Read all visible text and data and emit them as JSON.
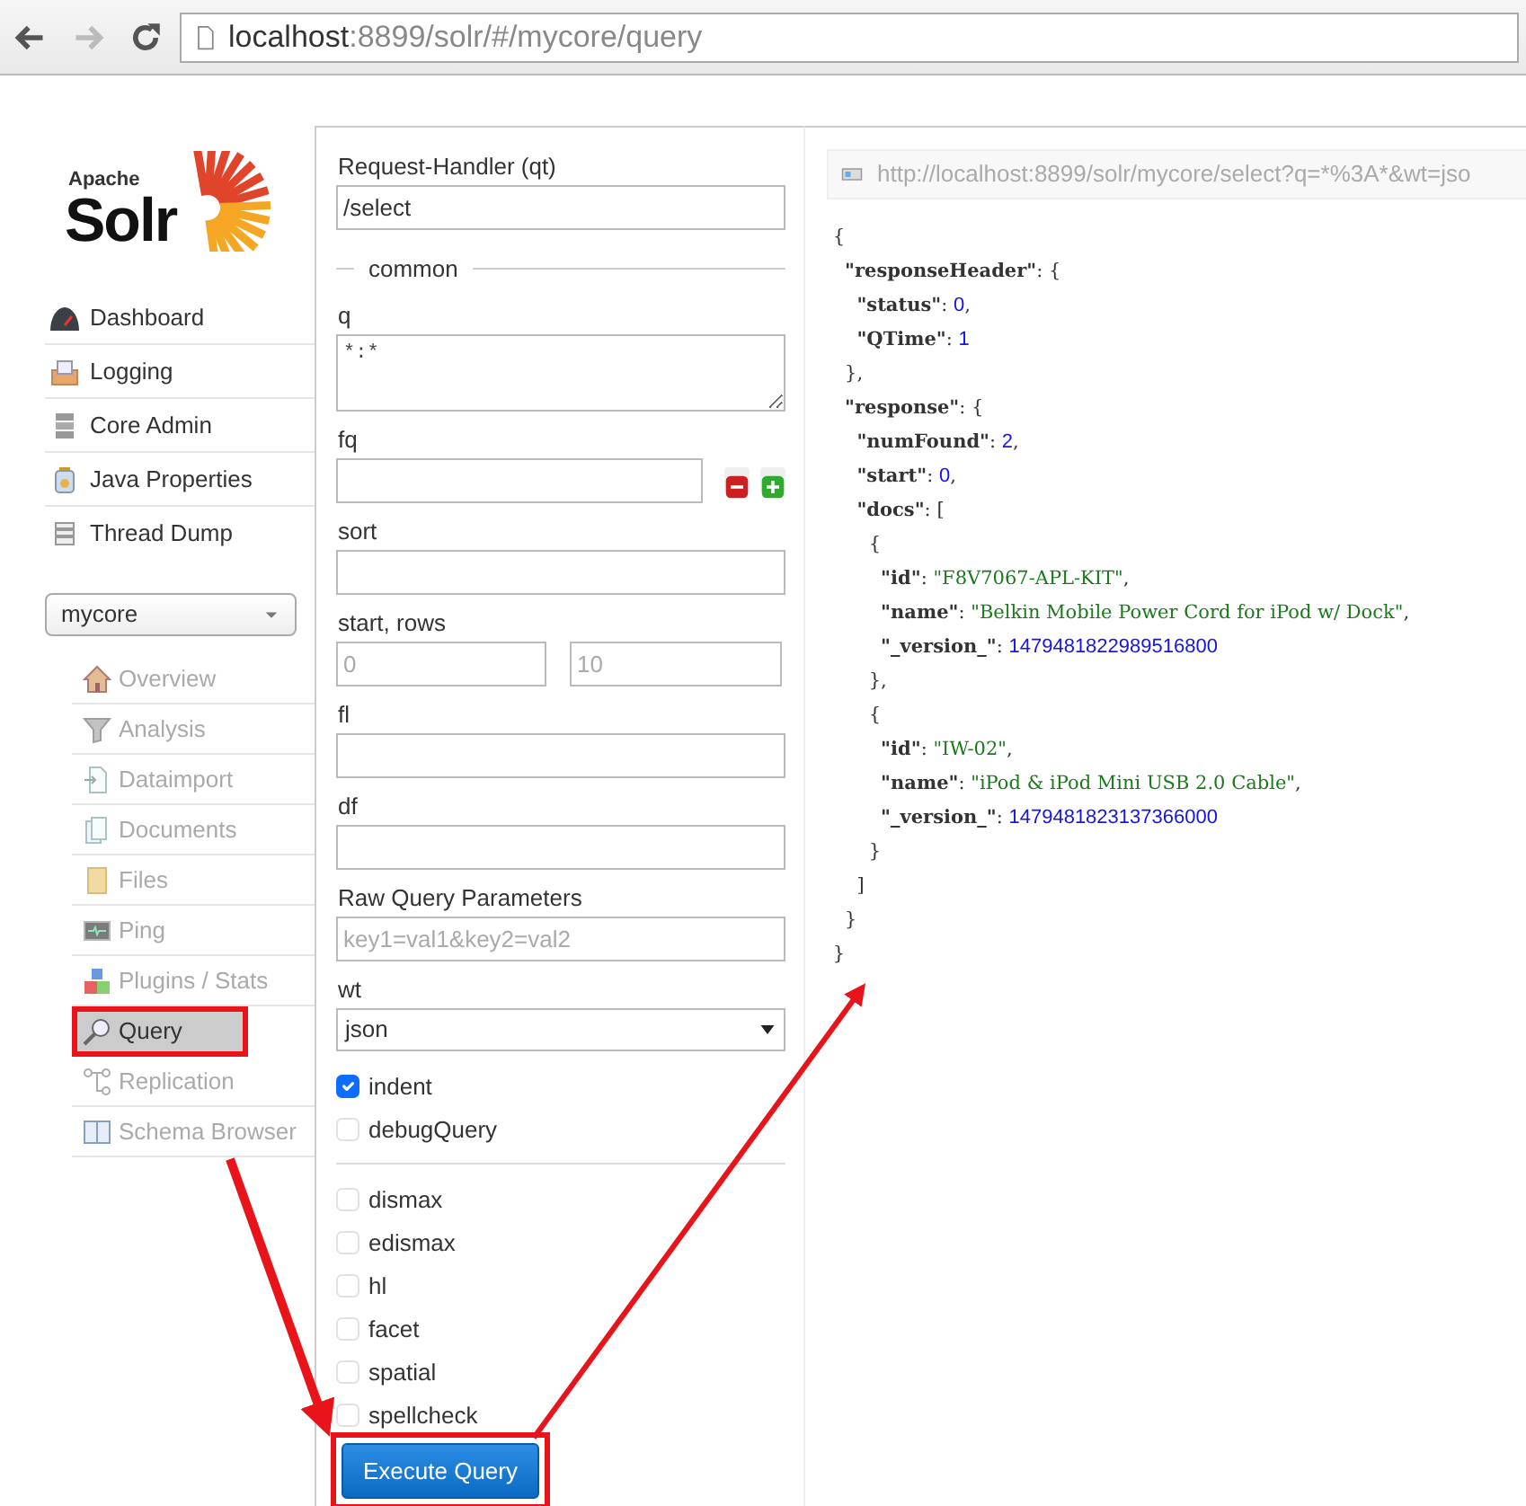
{
  "browser": {
    "url_host": "localhost",
    "url_path": ":8899/solr/#/mycore/query",
    "forward_disabled": true
  },
  "logo": {
    "small": "Apache",
    "big": "Solr"
  },
  "main_nav": [
    {
      "label": "Dashboard"
    },
    {
      "label": "Logging"
    },
    {
      "label": "Core Admin"
    },
    {
      "label": "Java Properties"
    },
    {
      "label": "Thread Dump"
    }
  ],
  "core_selector": {
    "value": "mycore"
  },
  "core_nav": [
    {
      "label": "Overview",
      "selected": false,
      "highlighted": false
    },
    {
      "label": "Analysis",
      "selected": false,
      "highlighted": false
    },
    {
      "label": "Dataimport",
      "selected": false,
      "highlighted": false
    },
    {
      "label": "Documents",
      "selected": false,
      "highlighted": false
    },
    {
      "label": "Files",
      "selected": false,
      "highlighted": false
    },
    {
      "label": "Ping",
      "selected": false,
      "highlighted": false
    },
    {
      "label": "Plugins / Stats",
      "selected": false,
      "highlighted": false
    },
    {
      "label": "Query",
      "selected": true,
      "highlighted": true
    },
    {
      "label": "Replication",
      "selected": false,
      "highlighted": false
    },
    {
      "label": "Schema Browser",
      "selected": false,
      "highlighted": false
    }
  ],
  "form": {
    "handler": {
      "label": "Request-Handler (qt)",
      "value": "/select"
    },
    "legend": "common",
    "q": {
      "label": "q",
      "value": "*:*"
    },
    "fq": {
      "label": "fq"
    },
    "sort": {
      "label": "sort"
    },
    "start_rows": {
      "label": "start, rows",
      "start_placeholder": "0",
      "rows_placeholder": "10"
    },
    "fl": {
      "label": "fl"
    },
    "df": {
      "label": "df"
    },
    "raw": {
      "label": "Raw Query Parameters",
      "placeholder": "key1=val1&key2=val2"
    },
    "wt": {
      "label": "wt",
      "value": "json"
    },
    "options": [
      {
        "label": "indent",
        "checked": true
      },
      {
        "label": "debugQuery",
        "checked": false
      }
    ],
    "parsers": [
      {
        "label": "dismax",
        "checked": false
      },
      {
        "label": "edismax",
        "checked": false
      },
      {
        "label": "hl",
        "checked": false
      },
      {
        "label": "facet",
        "checked": false
      },
      {
        "label": "spatial",
        "checked": false
      },
      {
        "label": "spellcheck",
        "checked": false
      }
    ],
    "execute": {
      "label": "Execute Query",
      "highlighted": true
    }
  },
  "result": {
    "url": "http://localhost:8899/solr/mycore/select?q=*%3A*&wt=jso",
    "json": {
      "open": "{",
      "close": "}",
      "children": [
        {
          "key": "\"responseHeader\"",
          "colon": ":",
          "open": "{",
          "close": "},",
          "children": [
            {
              "key": "\"status\"",
              "colon": ":",
              "value": "0",
              "kind": "number",
              "tail": ","
            },
            {
              "key": "\"QTime\"",
              "colon": ":",
              "value": "1",
              "kind": "number"
            }
          ]
        },
        {
          "key": "\"response\"",
          "colon": ":",
          "open": "{",
          "close": "}",
          "children": [
            {
              "key": "\"numFound\"",
              "colon": ":",
              "value": "2",
              "kind": "number",
              "tail": ","
            },
            {
              "key": "\"start\"",
              "colon": ":",
              "value": "0",
              "kind": "number",
              "tail": ","
            },
            {
              "key": "\"docs\"",
              "colon": ":",
              "open": "[",
              "close": "]",
              "children": [
                {
                  "open": "{",
                  "close": "},",
                  "children": [
                    {
                      "key": "\"id\"",
                      "colon": ":",
                      "value": "\"F8V7067-APL-KIT\"",
                      "kind": "string",
                      "tail": ","
                    },
                    {
                      "key": "\"name\"",
                      "colon": ":",
                      "value": "\"Belkin Mobile Power Cord for iPod w/ Dock\"",
                      "kind": "string",
                      "tail": ","
                    },
                    {
                      "key": "\"_version_\"",
                      "colon": ":",
                      "value": "1479481822989516800",
                      "kind": "number"
                    }
                  ]
                },
                {
                  "open": "{",
                  "close": "}",
                  "children": [
                    {
                      "key": "\"id\"",
                      "colon": ":",
                      "value": "\"IW-02\"",
                      "kind": "string",
                      "tail": ","
                    },
                    {
                      "key": "\"name\"",
                      "colon": ":",
                      "value": "\"iPod & iPod Mini USB 2.0 Cable\"",
                      "kind": "string",
                      "tail": ","
                    },
                    {
                      "key": "\"_version_\"",
                      "colon": ":",
                      "value": "1479481823137366000",
                      "kind": "number"
                    }
                  ]
                }
              ]
            }
          ]
        }
      ]
    }
  }
}
